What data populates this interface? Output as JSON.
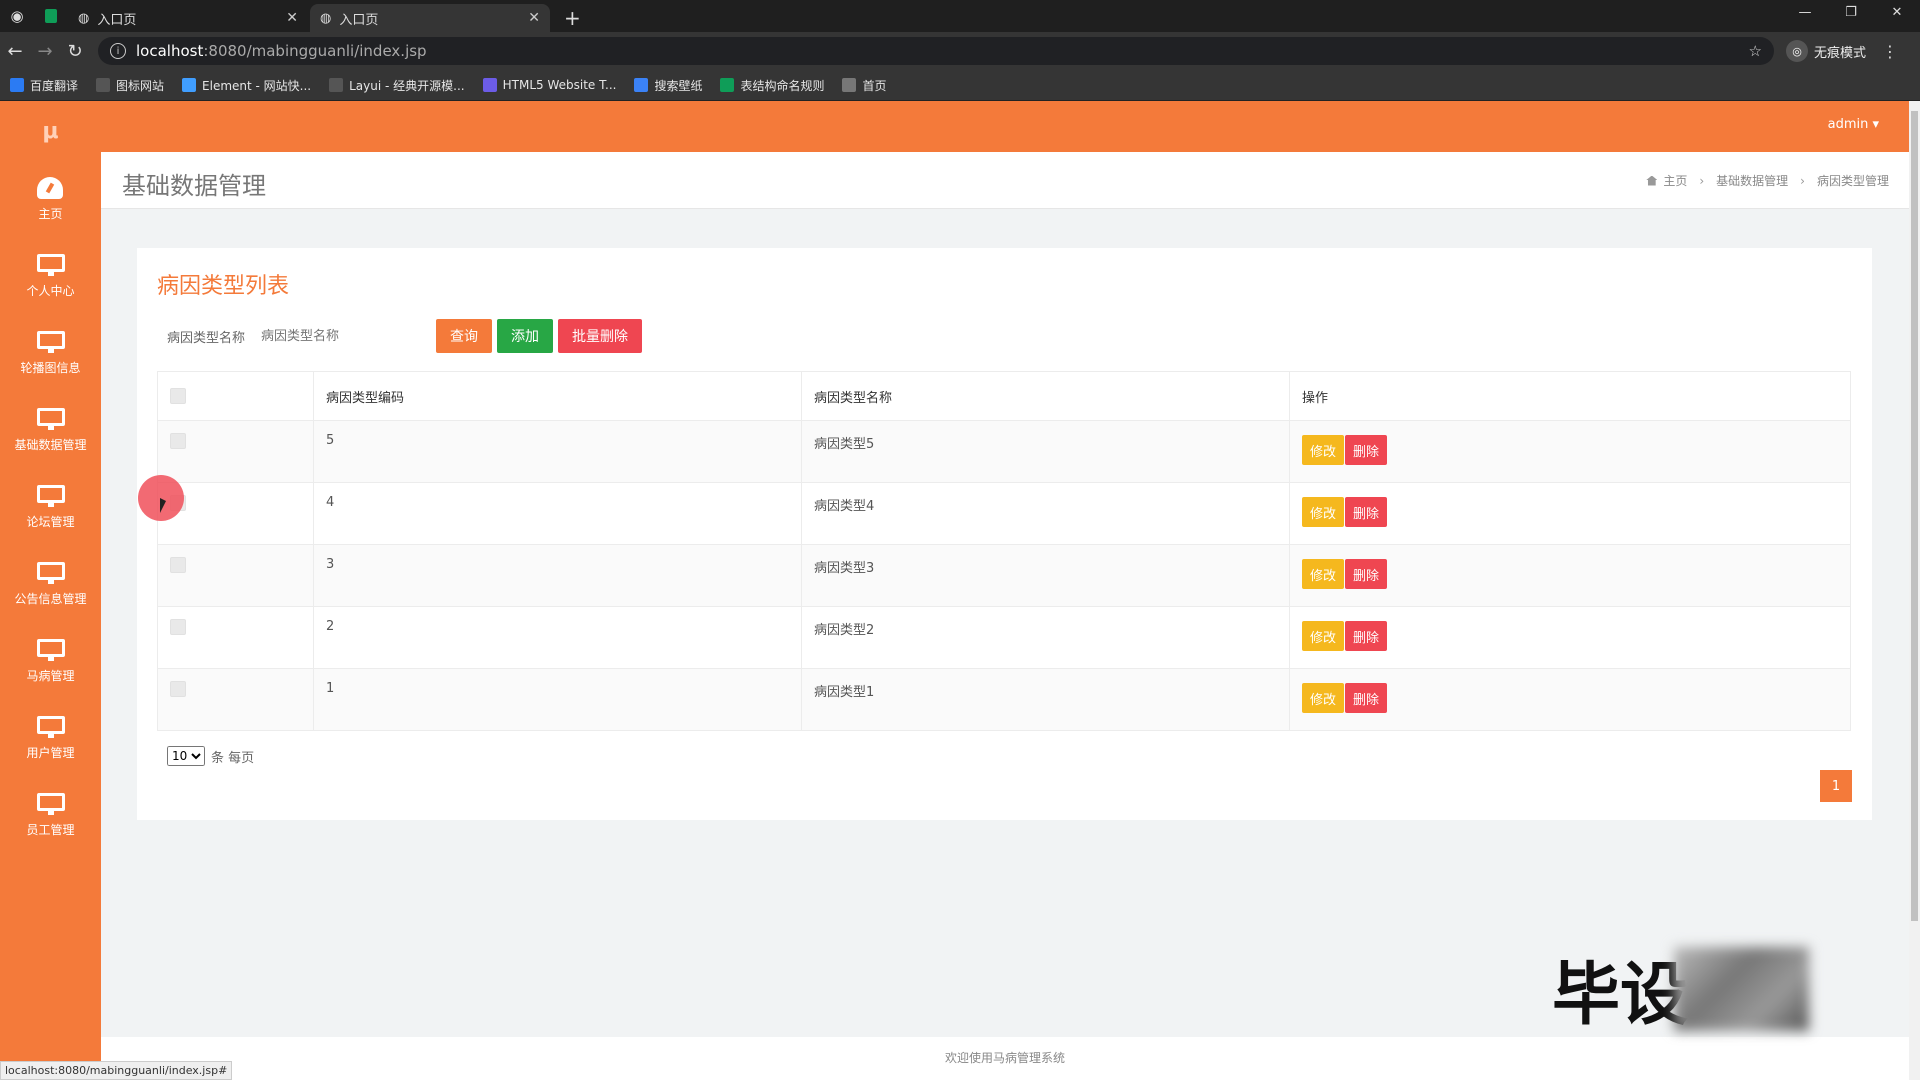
{
  "browser": {
    "tabs": [
      {
        "title": "入口页",
        "active": false
      },
      {
        "title": "入口页",
        "active": true
      }
    ],
    "url_host": "localhost",
    "url_path": ":8080/mabingguanli/index.jsp",
    "profile_label": "无痕模式",
    "bookmarks": [
      {
        "label": "百度翻译",
        "icon": "translate-icon",
        "color": "#2b7bf3"
      },
      {
        "label": "图标网站",
        "icon": "flag-icon",
        "color": "#555"
      },
      {
        "label": "Element - 网站快...",
        "icon": "element-icon",
        "color": "#409eff"
      },
      {
        "label": "Layui - 经典开源模...",
        "icon": "layui-icon",
        "color": "#555"
      },
      {
        "label": "HTML5 Website T...",
        "icon": "html5-icon",
        "color": "#6c5ce7"
      },
      {
        "label": "搜索壁纸",
        "icon": "wallpaper-icon",
        "color": "#3b82f6"
      },
      {
        "label": "表结构命名规则",
        "icon": "sheet-icon",
        "color": "#0f9d58"
      },
      {
        "label": "首页",
        "icon": "globe-icon",
        "color": "#777"
      }
    ],
    "status_url": "localhost:8080/mabingguanli/index.jsp#"
  },
  "sidebar": {
    "logo": "μ",
    "items": [
      {
        "label": "主页",
        "icon": "dashboard-icon"
      },
      {
        "label": "个人中心",
        "icon": "monitor-icon"
      },
      {
        "label": "轮播图信息",
        "icon": "monitor-icon"
      },
      {
        "label": "基础数据管理",
        "icon": "monitor-icon"
      },
      {
        "label": "论坛管理",
        "icon": "monitor-icon"
      },
      {
        "label": "公告信息管理",
        "icon": "monitor-icon"
      },
      {
        "label": "马病管理",
        "icon": "monitor-icon"
      },
      {
        "label": "用户管理",
        "icon": "monitor-icon"
      },
      {
        "label": "员工管理",
        "icon": "monitor-icon"
      }
    ]
  },
  "topbar": {
    "user": "admin ▾"
  },
  "header": {
    "title": "基础数据管理",
    "breadcrumb": [
      "主页",
      "基础数据管理",
      "病因类型管理"
    ]
  },
  "card": {
    "title": "病因类型列表",
    "search_label": "病因类型名称",
    "search_placeholder": "病因类型名称",
    "query_label": "查询",
    "add_label": "添加",
    "batch_delete_label": "批量删除"
  },
  "table": {
    "headers": [
      "",
      "病因类型编码",
      "病因类型名称",
      "操作"
    ],
    "rows": [
      {
        "code": "5",
        "name": "病因类型5"
      },
      {
        "code": "4",
        "name": "病因类型4"
      },
      {
        "code": "3",
        "name": "病因类型3"
      },
      {
        "code": "2",
        "name": "病因类型2"
      },
      {
        "code": "1",
        "name": "病因类型1"
      }
    ],
    "edit_label": "修改",
    "delete_label": "删除"
  },
  "pager": {
    "page_size": "10",
    "per_page_label": "条 每页",
    "current_page": "1"
  },
  "footer": {
    "text": "欢迎使用马病管理系统"
  },
  "watermark": {
    "text": "毕设"
  },
  "colors": {
    "primary": "#f47a3a",
    "success": "#28a745",
    "danger": "#ef4651",
    "warning": "#f5b81e"
  }
}
